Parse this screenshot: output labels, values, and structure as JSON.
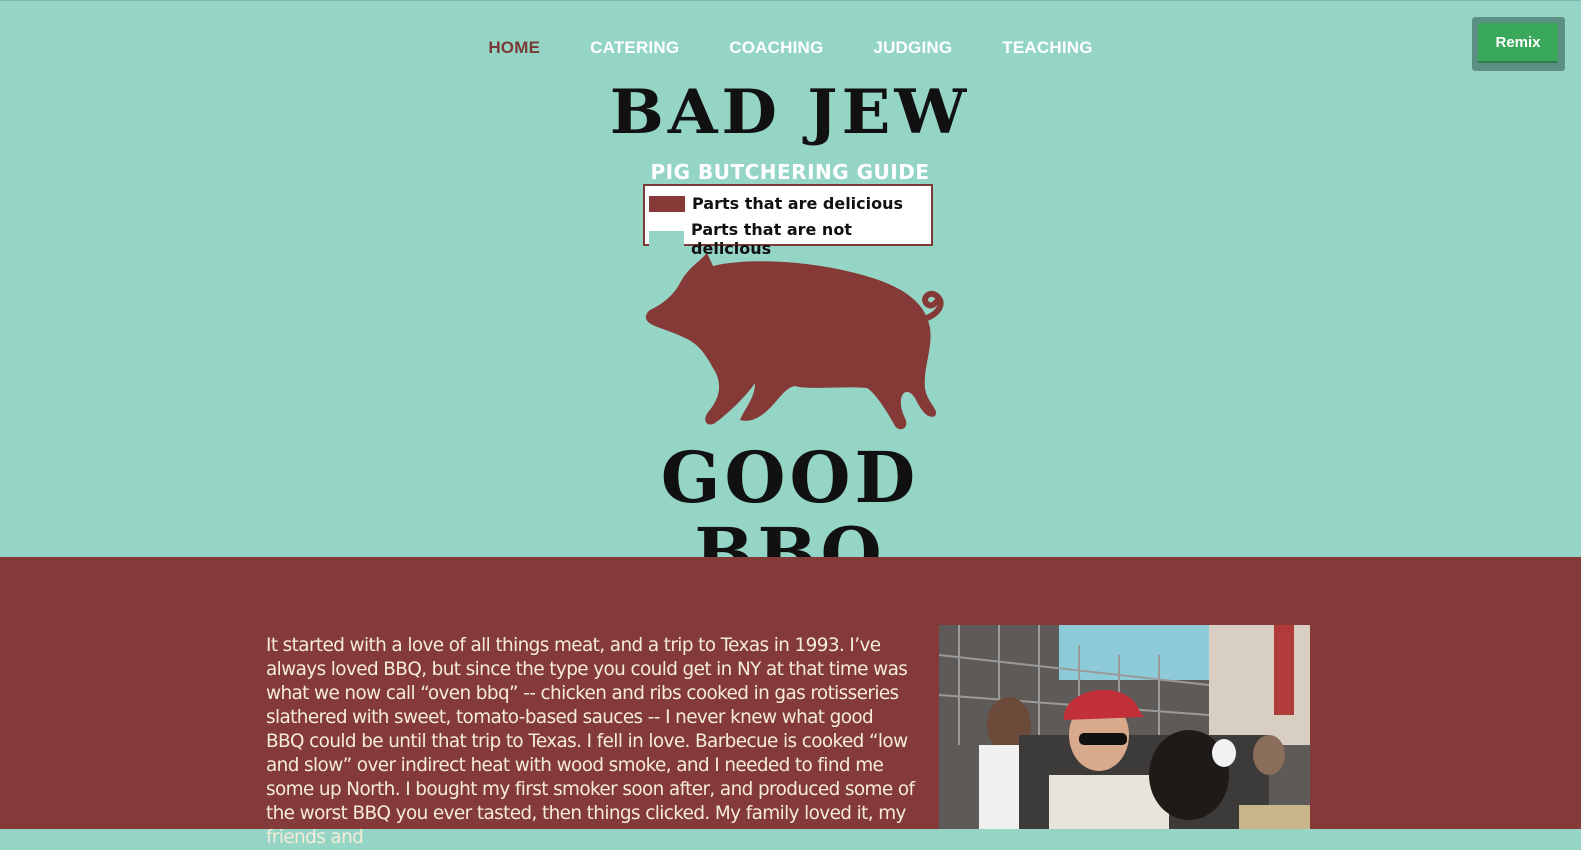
{
  "nav": {
    "items": [
      {
        "label": "HOME",
        "active": true
      },
      {
        "label": "CATERING",
        "active": false
      },
      {
        "label": "COACHING",
        "active": false
      },
      {
        "label": "JUDGING",
        "active": false
      },
      {
        "label": "TEACHING",
        "active": false
      }
    ]
  },
  "remix": {
    "label": "Remix"
  },
  "hero": {
    "title_top": "BAD JEW",
    "guide_title": "PIG BUTCHERING GUIDE",
    "legend": {
      "delicious": "Parts that are delicious",
      "not_delicious": "Parts that are not delicious"
    },
    "title_bottom": "GOOD BBQ"
  },
  "colors": {
    "background": "#95d5c6",
    "accent": "#843a39",
    "remix_button": "#3aa85a"
  },
  "content": {
    "story": "It started with a love of all things meat, and a trip to Texas in 1993. I’ve always loved BBQ, but since the type you could get in NY at that time was what we now call “oven bbq” -- chicken and ribs cooked in gas rotisseries slathered with sweet, tomato-based sauces -- I never knew what good BBQ could be until that trip to Texas. I fell in love. Barbecue is cooked “low and slow” over indirect heat with wood smoke, and I needed to find me some up North. I bought my first smoker soon after, and produced some of the worst BBQ you ever tasted, then things clicked. My family loved it, my friends and"
  }
}
